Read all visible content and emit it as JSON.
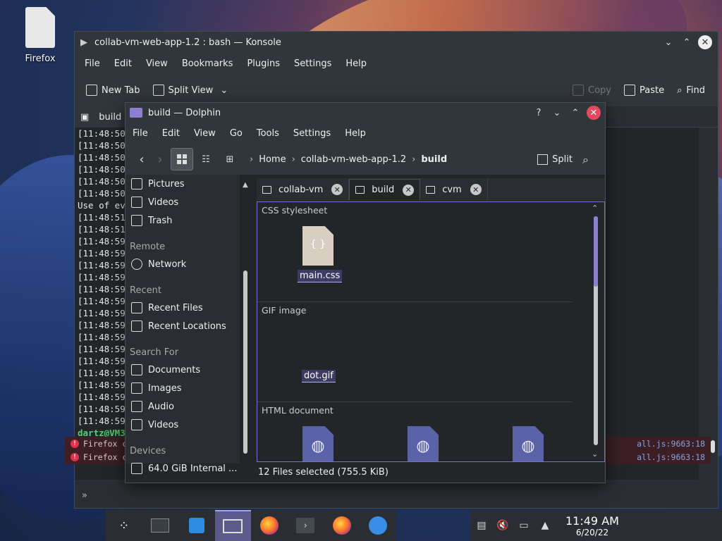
{
  "desktop": {
    "icon_label": "Firefox"
  },
  "konsole": {
    "title": "collab-vm-web-app-1.2 : bash — Konsole",
    "menu": [
      "File",
      "Edit",
      "View",
      "Bookmarks",
      "Plugins",
      "Settings",
      "Help"
    ],
    "toolbar": {
      "new_tab": "New Tab",
      "split_view": "Split View",
      "copy": "Copy",
      "paste": "Paste",
      "find": "Find"
    },
    "tab_label": "build",
    "lines": [
      "[11:48:50",
      "[11:48:50",
      "[11:48:50",
      "[11:48:50",
      "[11:48:50",
      "[11:48:50",
      "Use of ev                                                                       fication",
      "[11:48:51",
      "[11:48:51",
      "[11:48:59",
      "[11:48:59",
      "[11:48:59",
      "[11:48:59",
      "[11:48:59",
      "[11:48:59",
      "[11:48:59",
      "[11:48:59",
      "[11:48:59",
      "[11:48:59",
      "[11:48:59",
      "[11:48:59",
      "[11:48:59",
      "[11:48:59",
      "[11:48:59",
      "[11:48:59"
    ],
    "prompt": "dartz@VM3",
    "errors": [
      {
        "text": "Firefox c",
        "loc": "all.js:9663:18"
      },
      {
        "text": "Firefox c",
        "loc": "all.js:9663:18"
      }
    ],
    "status_icon": "»"
  },
  "dolphin": {
    "title": "build — Dolphin",
    "menu": [
      "File",
      "Edit",
      "View",
      "Go",
      "Tools",
      "Settings",
      "Help"
    ],
    "breadcrumbs": [
      "Home",
      "collab-vm-web-app-1.2",
      "build"
    ],
    "split_label": "Split",
    "sidebar": {
      "top_items": [
        "Pictures",
        "Videos",
        "Trash"
      ],
      "remote_head": "Remote",
      "remote_items": [
        "Network"
      ],
      "recent_head": "Recent",
      "recent_items": [
        "Recent Files",
        "Recent Locations"
      ],
      "search_head": "Search For",
      "search_items": [
        "Documents",
        "Images",
        "Audio",
        "Videos"
      ],
      "devices_head": "Devices",
      "devices_items": [
        "64.0 GiB Internal ..."
      ]
    },
    "tabs": [
      "collab-vm",
      "build",
      "cvm"
    ],
    "groups": [
      {
        "header": "CSS stylesheet",
        "files": [
          "main.css"
        ]
      },
      {
        "header": "GIF image",
        "files": [
          "dot.gif"
        ]
      },
      {
        "header": "HTML document",
        "files": []
      }
    ],
    "status": "12 Files selected (755.5 KiB)"
  },
  "taskbar": {
    "time": "11:49 AM",
    "date": "6/20/22"
  }
}
